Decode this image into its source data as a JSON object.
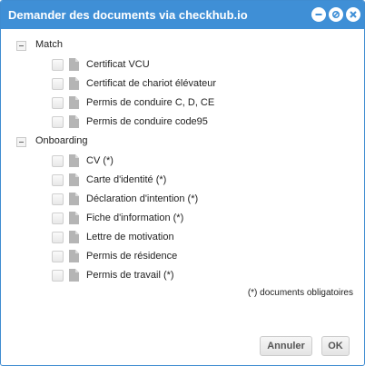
{
  "window": {
    "title": "Demander des documents via checkhub.io",
    "controls": [
      "minimize-icon",
      "restore-icon",
      "close-icon"
    ]
  },
  "groups": [
    {
      "label": "Match",
      "items": [
        "Certificat VCU",
        "Certificat de chariot élévateur",
        "Permis de conduire C, D, CE",
        "Permis de conduire code95"
      ]
    },
    {
      "label": "Onboarding",
      "items": [
        "CV (*)",
        "Carte d'identité (*)",
        "Déclaration d'intention (*)",
        "Fiche d'information (*)",
        "Lettre de motivation",
        "Permis de résidence",
        "Permis de travail (*)"
      ]
    }
  ],
  "note": "(*) documents obligatoires",
  "buttons": {
    "cancel": "Annuler",
    "ok": "OK"
  },
  "colors": {
    "titlebar": "#3f8fd6",
    "border": "#3f8cd1"
  }
}
